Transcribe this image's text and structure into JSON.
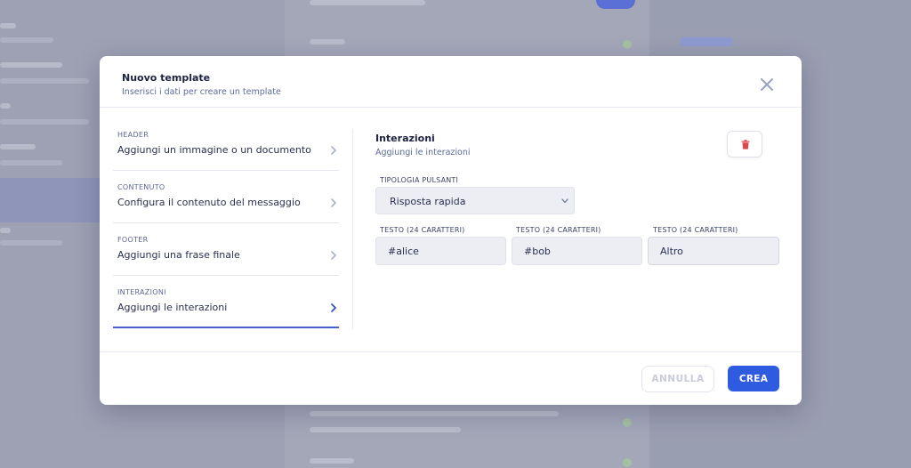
{
  "modal": {
    "title": "Nuovo template",
    "subtitle": "Inserisci i dati per creare un template"
  },
  "steps": [
    {
      "label": "HEADER",
      "description": "Aggiungi un immagine o un documento"
    },
    {
      "label": "CONTENUTO",
      "description": "Configura il contenuto del messaggio"
    },
    {
      "label": "FOOTER",
      "description": "Aggiungi una frase finale"
    },
    {
      "label": "INTERAZIONI",
      "description": "Aggiungi le interazioni",
      "active": true
    }
  ],
  "panel": {
    "title": "Interazioni",
    "subtitle": "Aggiungi le interazioni",
    "button_type_label": "TIPOLOGIA PULSANTI",
    "button_type_value": "Risposta rapida",
    "text_fields": [
      {
        "label": "TESTO (24 CARATTERI)",
        "value": "#alice"
      },
      {
        "label": "TESTO (24 CARATTERI)",
        "value": "#bob"
      },
      {
        "label": "TESTO (24 CARATTERI)",
        "value": "Altro"
      }
    ]
  },
  "footer": {
    "cancel_label": "ANNULLA",
    "create_label": "CREA"
  },
  "colors": {
    "accent": "#2f5be0",
    "delete_icon": "#e0454f",
    "overlay": "#9398ab"
  },
  "icons": {
    "close": "close-icon",
    "chevron": "chevron-right-icon",
    "delete": "trash-icon",
    "select_arrow": "chevron-down-icon"
  }
}
